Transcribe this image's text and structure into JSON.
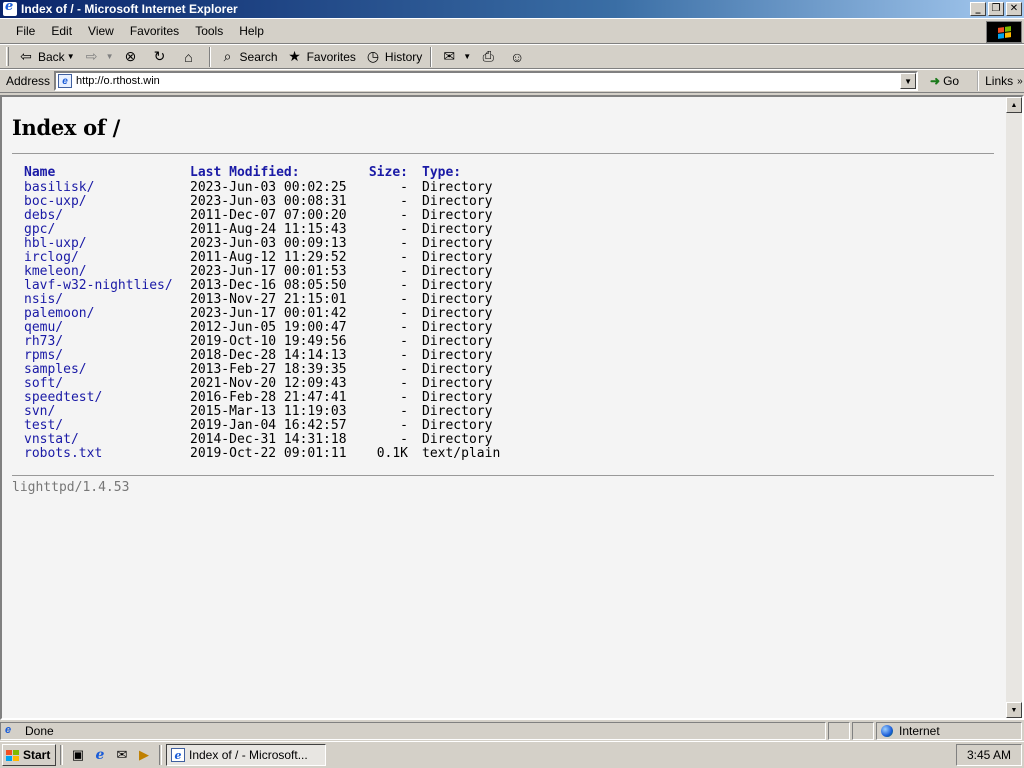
{
  "window": {
    "title": "Index of / - Microsoft Internet Explorer",
    "minimize_label": "_",
    "maximize_label": "❐",
    "close_label": "✕"
  },
  "menu": {
    "items": [
      "File",
      "Edit",
      "View",
      "Favorites",
      "Tools",
      "Help"
    ]
  },
  "toolbar": {
    "back_label": "Back",
    "search_label": "Search",
    "favorites_label": "Favorites",
    "history_label": "History"
  },
  "address": {
    "label": "Address",
    "url": "http://o.rthost.win",
    "go_label": "Go",
    "links_label": "Links"
  },
  "page": {
    "heading": "Index of /",
    "columns": {
      "name": "Name",
      "modified": "Last Modified:",
      "size": "Size:",
      "type": "Type:"
    },
    "rows": [
      {
        "name": "basilisk/",
        "modified": "2023-Jun-03 00:02:25",
        "size": "-",
        "type": "Directory"
      },
      {
        "name": "boc-uxp/",
        "modified": "2023-Jun-03 00:08:31",
        "size": "-",
        "type": "Directory"
      },
      {
        "name": "debs/",
        "modified": "2011-Dec-07 07:00:20",
        "size": "-",
        "type": "Directory"
      },
      {
        "name": "gpc/",
        "modified": "2011-Aug-24 11:15:43",
        "size": "-",
        "type": "Directory"
      },
      {
        "name": "hbl-uxp/",
        "modified": "2023-Jun-03 00:09:13",
        "size": "-",
        "type": "Directory"
      },
      {
        "name": "irclog/",
        "modified": "2011-Aug-12 11:29:52",
        "size": "-",
        "type": "Directory"
      },
      {
        "name": "kmeleon/",
        "modified": "2023-Jun-17 00:01:53",
        "size": "-",
        "type": "Directory"
      },
      {
        "name": "lavf-w32-nightlies/",
        "modified": "2013-Dec-16 08:05:50",
        "size": "-",
        "type": "Directory"
      },
      {
        "name": "nsis/",
        "modified": "2013-Nov-27 21:15:01",
        "size": "-",
        "type": "Directory"
      },
      {
        "name": "palemoon/",
        "modified": "2023-Jun-17 00:01:42",
        "size": "-",
        "type": "Directory"
      },
      {
        "name": "qemu/",
        "modified": "2012-Jun-05 19:00:47",
        "size": "-",
        "type": "Directory"
      },
      {
        "name": "rh73/",
        "modified": "2019-Oct-10 19:49:56",
        "size": "-",
        "type": "Directory"
      },
      {
        "name": "rpms/",
        "modified": "2018-Dec-28 14:14:13",
        "size": "-",
        "type": "Directory"
      },
      {
        "name": "samples/",
        "modified": "2013-Feb-27 18:39:35",
        "size": "-",
        "type": "Directory"
      },
      {
        "name": "soft/",
        "modified": "2021-Nov-20 12:09:43",
        "size": "-",
        "type": "Directory"
      },
      {
        "name": "speedtest/",
        "modified": "2016-Feb-28 21:47:41",
        "size": "-",
        "type": "Directory"
      },
      {
        "name": "svn/",
        "modified": "2015-Mar-13 11:19:03",
        "size": "-",
        "type": "Directory"
      },
      {
        "name": "test/",
        "modified": "2019-Jan-04 16:42:57",
        "size": "-",
        "type": "Directory"
      },
      {
        "name": "vnstat/",
        "modified": "2014-Dec-31 14:31:18",
        "size": "-",
        "type": "Directory"
      },
      {
        "name": "robots.txt",
        "modified": "2019-Oct-22 09:01:11",
        "size": "0.1K",
        "type": "text/plain"
      }
    ],
    "server_signature": "lighttpd/1.4.53"
  },
  "status": {
    "text": "Done",
    "zone": "Internet"
  },
  "taskbar": {
    "start_label": "Start",
    "task_label": "Index of / - Microsoft...",
    "clock": "3:45 AM"
  },
  "colors": {
    "title_gradient_start": "#0a246a",
    "link_blue": "#1a1aa6",
    "chrome_gray": "#d4d0c8"
  }
}
